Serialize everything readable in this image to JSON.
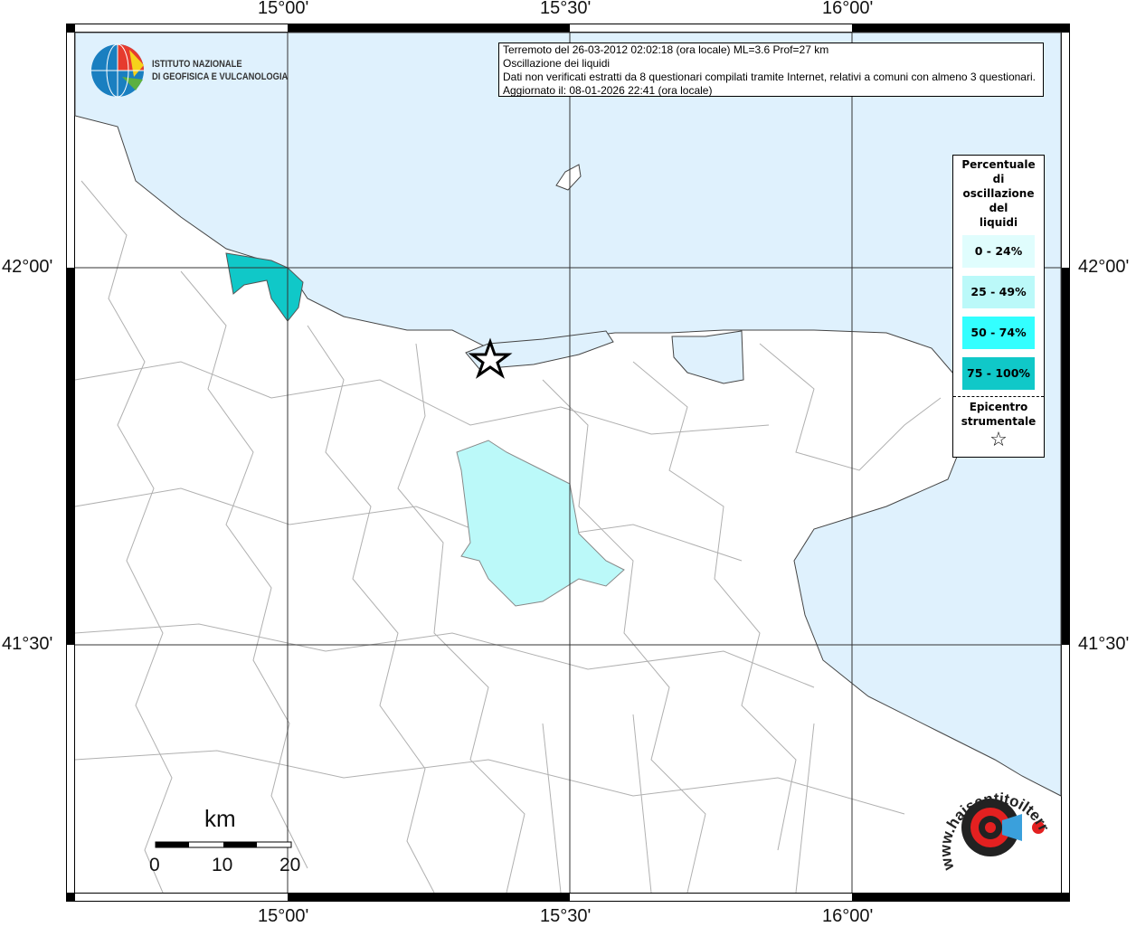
{
  "logo": {
    "name_line1": "ISTITUTO NAZIONALE",
    "name_line2": "DI GEOFISICA E VULCANOLOGIA"
  },
  "info": {
    "line1": "Terremoto del 26-03-2012 02:02:18 (ora locale) ML=3.6 Prof=27 km",
    "line2": "Oscillazione dei liquidi",
    "line3": "Dati non verificati estratti da 8 questionari compilati tramite Internet, relativi a comuni con almeno 3 questionari.",
    "line4": "Aggiornato il: 08-01-2026 22:41 (ora locale)"
  },
  "axes": {
    "lon_ticks": [
      "15°00'",
      "15°30'",
      "16°00'"
    ],
    "lat_ticks": [
      "42°00'",
      "41°30'"
    ]
  },
  "legend": {
    "title_lines": [
      "Percentuale",
      "di",
      "oscillazione",
      "del",
      "liquidi"
    ],
    "classes": [
      {
        "label": "0 - 24%",
        "color": "#e0fdfd"
      },
      {
        "label": "25 - 49%",
        "color": "#bbf9f9"
      },
      {
        "label": "50 - 74%",
        "color": "#33ffff"
      },
      {
        "label": "75 - 100%",
        "color": "#10c8c8"
      }
    ],
    "epicenter_line1": "Epicentro",
    "epicenter_line2": "strumentale",
    "epicenter_symbol": "☆"
  },
  "scale": {
    "unit": "km",
    "labels": [
      "0",
      "10",
      "20"
    ]
  },
  "watermark": {
    "text": "www.haisentitoilterremoto.it"
  },
  "colors": {
    "sea": "#dff1fd",
    "frame": "#000000",
    "border": "#b0b0b0"
  }
}
